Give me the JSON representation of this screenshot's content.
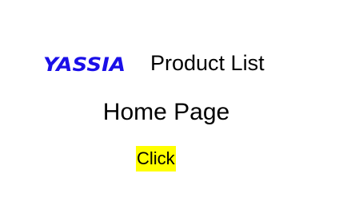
{
  "header": {
    "logo_text": "YASSIA",
    "logo_color": "#1a0fe8",
    "nav_link": "Product List"
  },
  "main": {
    "title": "Home Page",
    "button_label": "Click",
    "button_color": "#ffff00"
  }
}
